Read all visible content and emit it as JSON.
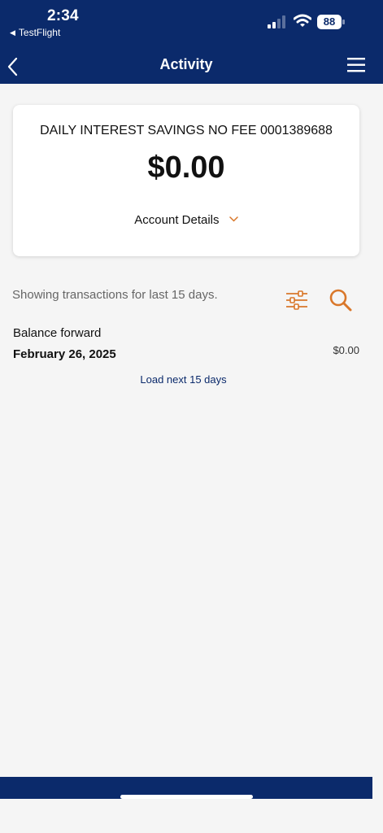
{
  "status_bar": {
    "time": "2:34",
    "back_app": "TestFlight",
    "battery": "88"
  },
  "nav": {
    "title": "Activity"
  },
  "account": {
    "name": "DAILY INTEREST SAVINGS NO FEE 0001389688",
    "balance": "$0.00",
    "details_label": "Account Details"
  },
  "transactions": {
    "showing_text": "Showing transactions for last 15 days.",
    "balance_forward_label": "Balance forward",
    "balance_forward_date": "February 26, 2025",
    "balance_forward_amount": "$0.00",
    "load_more": "Load next 15 days"
  },
  "colors": {
    "brand_navy": "#0b2a6b",
    "accent_orange": "#d9772a"
  },
  "icons": [
    "back-chevron-icon",
    "hamburger-menu-icon",
    "chevron-down-icon",
    "filter-sliders-icon",
    "search-icon",
    "signal-icon",
    "wifi-icon",
    "battery-icon"
  ]
}
